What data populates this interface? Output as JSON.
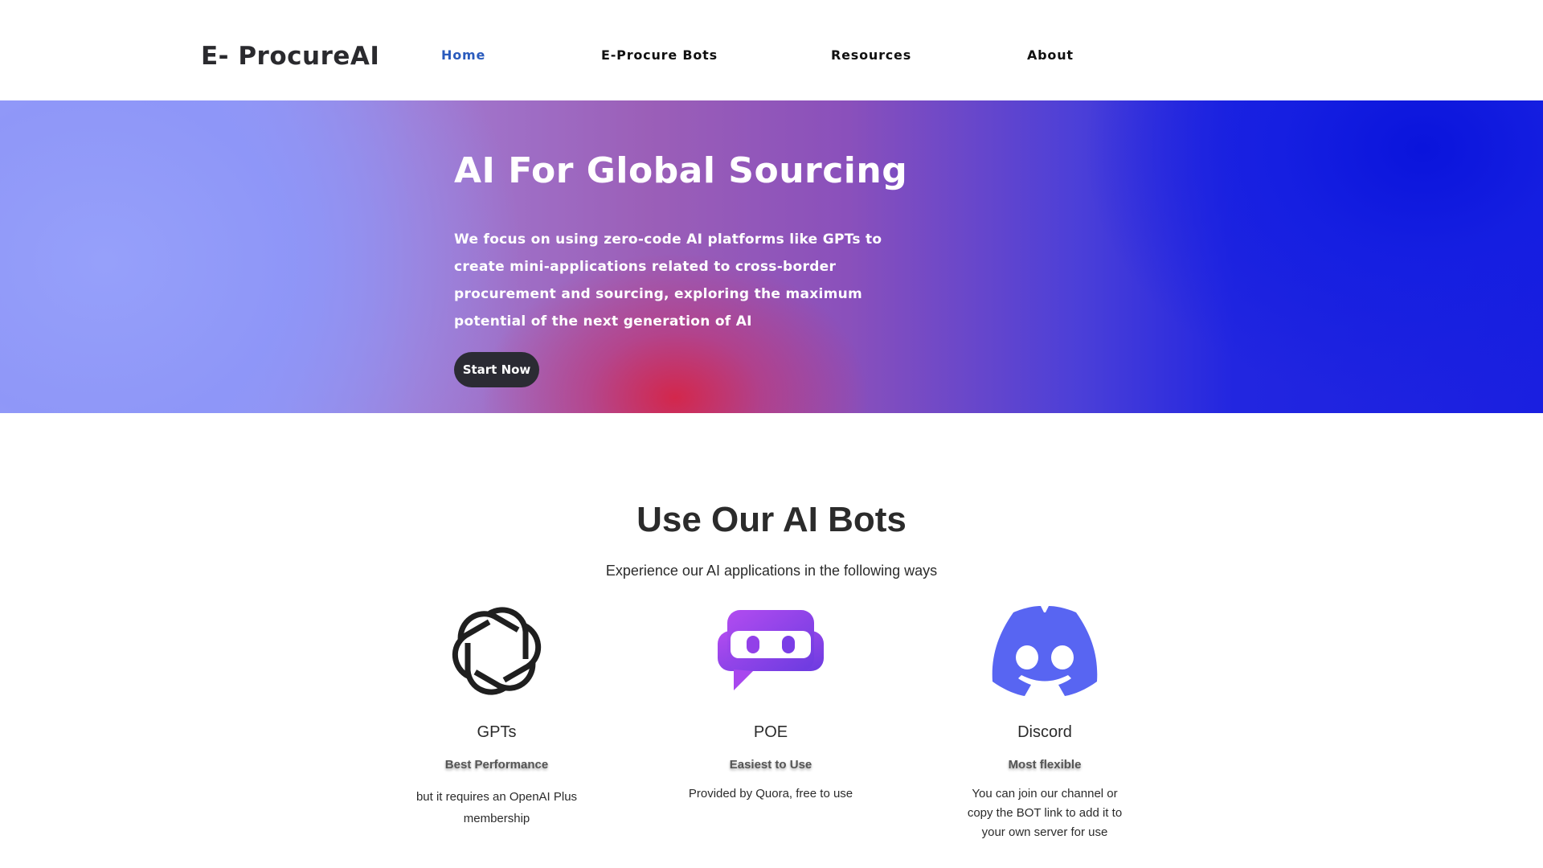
{
  "header": {
    "logo": "E- ProcureAI",
    "nav": [
      {
        "label": "Home",
        "active": true
      },
      {
        "label": "E-Procure Bots",
        "active": false
      },
      {
        "label": "Resources",
        "active": false
      },
      {
        "label": "About",
        "active": false
      }
    ]
  },
  "hero": {
    "title": "AI For Global Sourcing",
    "description": "We focus on using zero-code AI platforms like GPTs to create mini-applications related to cross-border procurement and sourcing, exploring the maximum potential of the next generation of AI",
    "cta_label": "Start Now"
  },
  "bots_section": {
    "title": "Use Our AI Bots",
    "subtitle": "Experience our AI applications in the following ways",
    "bots": [
      {
        "name": "GPTs",
        "tag": "Best Performance",
        "description": "but it requires an OpenAI Plus membership",
        "icon": "openai-icon"
      },
      {
        "name": "POE",
        "tag": "Easiest to Use",
        "description": "Provided by Quora, free to use",
        "icon": "poe-icon"
      },
      {
        "name": "Discord",
        "tag": "Most flexible",
        "description": "You can join our channel or copy the BOT link to add it to your own server for use",
        "icon": "discord-icon"
      }
    ]
  },
  "colors": {
    "active_nav": "#2a5bbd",
    "button_bg": "#2b2b33",
    "discord": "#5865f2",
    "poe": "#9b3ef0"
  }
}
